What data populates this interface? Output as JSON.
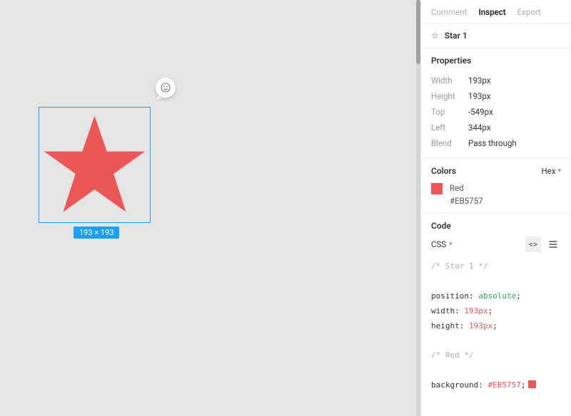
{
  "tabs": {
    "comment": "Comment",
    "inspect": "Inspect",
    "export": "Export"
  },
  "object": {
    "name": "Star 1"
  },
  "properties": {
    "title": "Properties",
    "width": {
      "label": "Width",
      "value": "193px"
    },
    "height": {
      "label": "Height",
      "value": "193px"
    },
    "top": {
      "label": "Top",
      "value": "-549px"
    },
    "left": {
      "label": "Left",
      "value": "344px"
    },
    "blend": {
      "label": "Blend",
      "value": "Pass through"
    }
  },
  "colors": {
    "title": "Colors",
    "format": "Hex",
    "name": "Red",
    "hex": "#EB5757"
  },
  "code": {
    "title": "Code",
    "lang": "CSS",
    "comment1": "/* Star 1 */",
    "l1a": "position: ",
    "l1b": "absolute",
    "l1c": ";",
    "l2a": "width: ",
    "l2b": "193px",
    "l2c": ";",
    "l3a": "height: ",
    "l3b": "193px",
    "l3c": ";",
    "comment2": "/* Red */",
    "l4a": "background: ",
    "l4b": "#EB5757",
    "l4c": ";"
  },
  "canvas": {
    "dimensions": "193 × 193",
    "star_fill": "#EB5757",
    "selection_color": "#18A0FB"
  }
}
